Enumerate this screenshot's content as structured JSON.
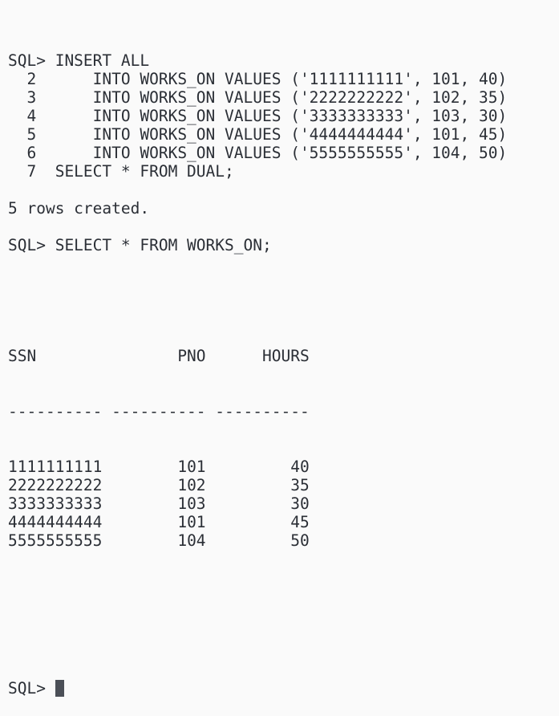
{
  "terminal": {
    "lines": [
      {
        "type": "text",
        "text": "SQL> INSERT ALL"
      },
      {
        "type": "text",
        "text": "  2      INTO WORKS_ON VALUES ('1111111111', 101, 40)"
      },
      {
        "type": "text",
        "text": "  3      INTO WORKS_ON VALUES ('2222222222', 102, 35)"
      },
      {
        "type": "text",
        "text": "  4      INTO WORKS_ON VALUES ('3333333333', 103, 30)"
      },
      {
        "type": "text",
        "text": "  5      INTO WORKS_ON VALUES ('4444444444', 101, 45)"
      },
      {
        "type": "text",
        "text": "  6      INTO WORKS_ON VALUES ('5555555555', 104, 50)"
      },
      {
        "type": "text",
        "text": "  7  SELECT * FROM DUAL;"
      },
      {
        "type": "blank",
        "text": ""
      },
      {
        "type": "text",
        "text": "5 rows created."
      },
      {
        "type": "blank",
        "text": ""
      },
      {
        "type": "text",
        "text": "SQL> SELECT * FROM WORKS_ON;"
      },
      {
        "type": "blank",
        "text": ""
      }
    ],
    "result_table": {
      "header": "SSN               PNO      HOURS",
      "separator": "---------- ---------- ----------",
      "columns": [
        "SSN",
        "PNO",
        "HOURS"
      ],
      "rows": [
        {
          "ssn": "1111111111",
          "pno": "101",
          "hours": "40"
        },
        {
          "ssn": "2222222222",
          "pno": "102",
          "hours": "35"
        },
        {
          "ssn": "3333333333",
          "pno": "103",
          "hours": "30"
        },
        {
          "ssn": "4444444444",
          "pno": "101",
          "hours": "45"
        },
        {
          "ssn": "5555555555",
          "pno": "104",
          "hours": "50"
        }
      ]
    },
    "prompt": "SQL> ",
    "colors": {
      "background": "#fafafa",
      "text": "#2b2f36",
      "cursor": "#4b4f57"
    }
  }
}
